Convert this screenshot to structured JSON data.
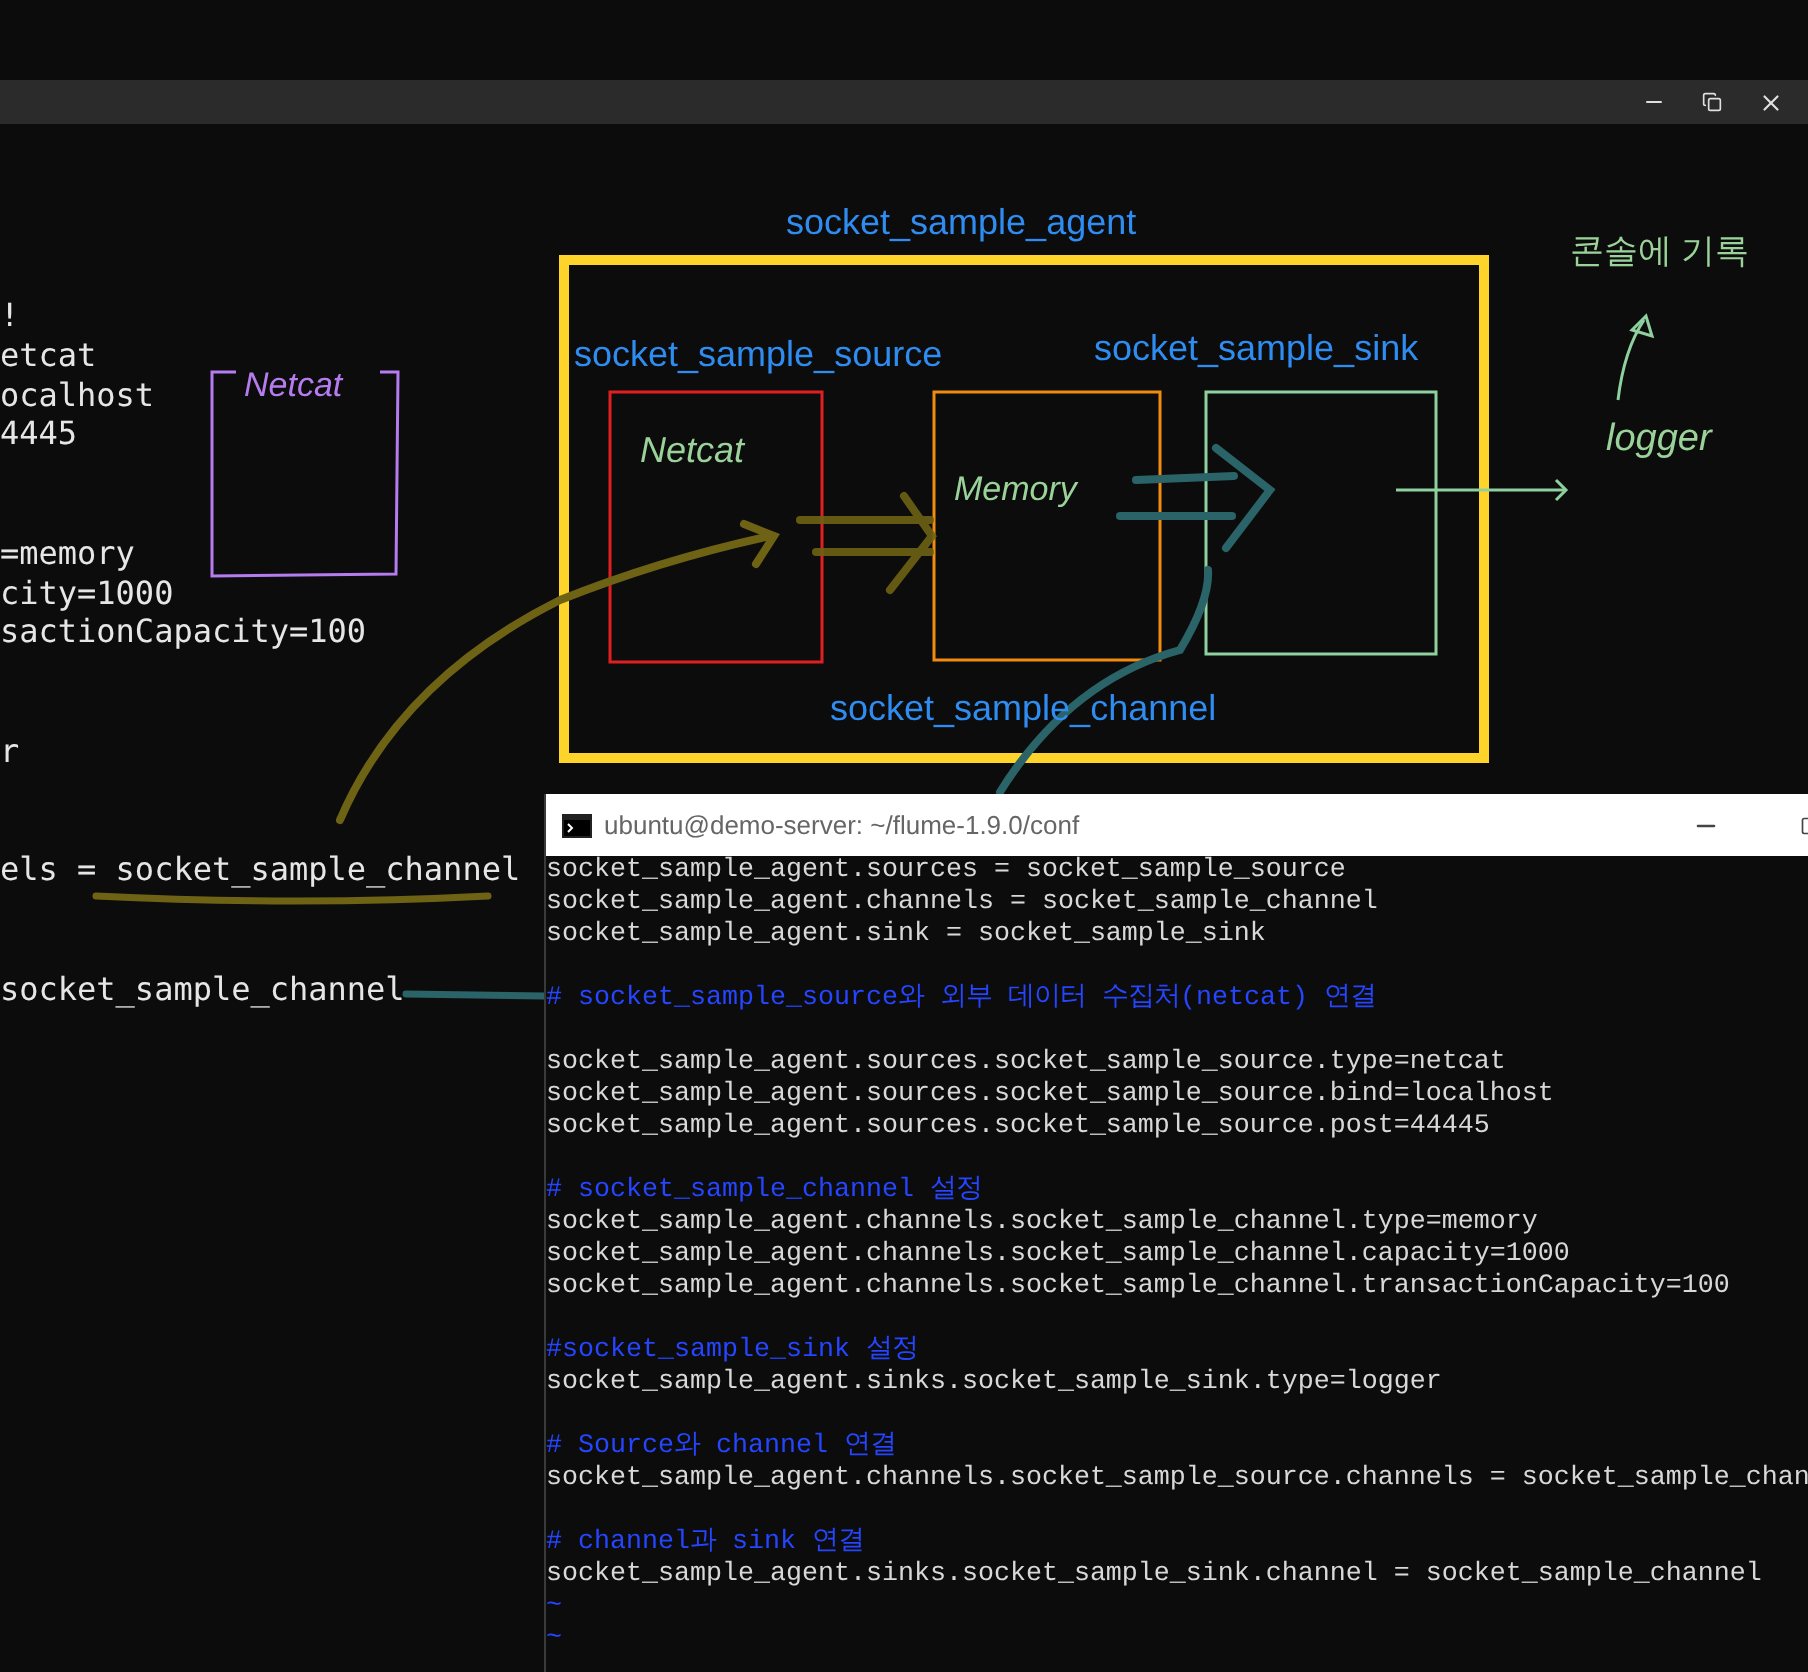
{
  "background_window": {
    "code_groups": [
      [
        "!",
        "etcat",
        "ocalhost",
        "4445"
      ],
      [
        "=memory",
        "city=1000",
        "sactionCapacity=100"
      ],
      [
        "r"
      ],
      [
        "els = socket_sample_channel"
      ],
      [
        "socket_sample_channel"
      ]
    ]
  },
  "diagram": {
    "agent_label": "socket_sample_agent",
    "source_label": "socket_sample_source",
    "sink_label": "socket_sample_sink",
    "channel_label": "socket_sample_channel",
    "side_note": "Netcat",
    "source_note": "Netcat",
    "channel_note": "Memory",
    "sink_note": "logger",
    "output_note": "콘솔에 기록"
  },
  "terminal": {
    "title": "ubuntu@demo-server: ~/flume-1.9.0/conf",
    "groups": [
      [
        {
          "kind": "code",
          "text": "socket_sample_agent.sources = socket_sample_source"
        },
        {
          "kind": "code",
          "text": "socket_sample_agent.channels = socket_sample_channel"
        },
        {
          "kind": "code",
          "text": "socket_sample_agent.sink = socket_sample_sink"
        }
      ],
      [
        {
          "kind": "comment",
          "text": "# socket_sample_source와 외부 데이터 수집처(netcat) 연결"
        }
      ],
      [
        {
          "kind": "code",
          "text": "socket_sample_agent.sources.socket_sample_source.type=netcat"
        },
        {
          "kind": "code",
          "text": "socket_sample_agent.sources.socket_sample_source.bind=localhost"
        },
        {
          "kind": "code",
          "text": "socket_sample_agent.sources.socket_sample_source.post=44445"
        }
      ],
      [
        {
          "kind": "comment",
          "text": "# socket_sample_channel 설정"
        },
        {
          "kind": "code",
          "text": "socket_sample_agent.channels.socket_sample_channel.type=memory"
        },
        {
          "kind": "code",
          "text": "socket_sample_agent.channels.socket_sample_channel.capacity=1000"
        },
        {
          "kind": "code",
          "text": "socket_sample_agent.channels.socket_sample_channel.transactionCapacity=100"
        }
      ],
      [
        {
          "kind": "comment",
          "text": "#socket_sample_sink 설정"
        },
        {
          "kind": "code",
          "text": "socket_sample_agent.sinks.socket_sample_sink.type=logger"
        }
      ],
      [
        {
          "kind": "comment",
          "text": "# Source와 channel 연결"
        },
        {
          "kind": "code",
          "text": "socket_sample_agent.channels.socket_sample_source.channels = socket_sample_chan"
        }
      ],
      [
        {
          "kind": "comment",
          "text": "# channel과 sink 연결"
        },
        {
          "kind": "code",
          "text": "socket_sample_agent.sinks.socket_sample_sink.channel = socket_sample_channel"
        },
        {
          "kind": "tilde",
          "text": "~"
        },
        {
          "kind": "tilde",
          "text": "~"
        }
      ]
    ]
  }
}
